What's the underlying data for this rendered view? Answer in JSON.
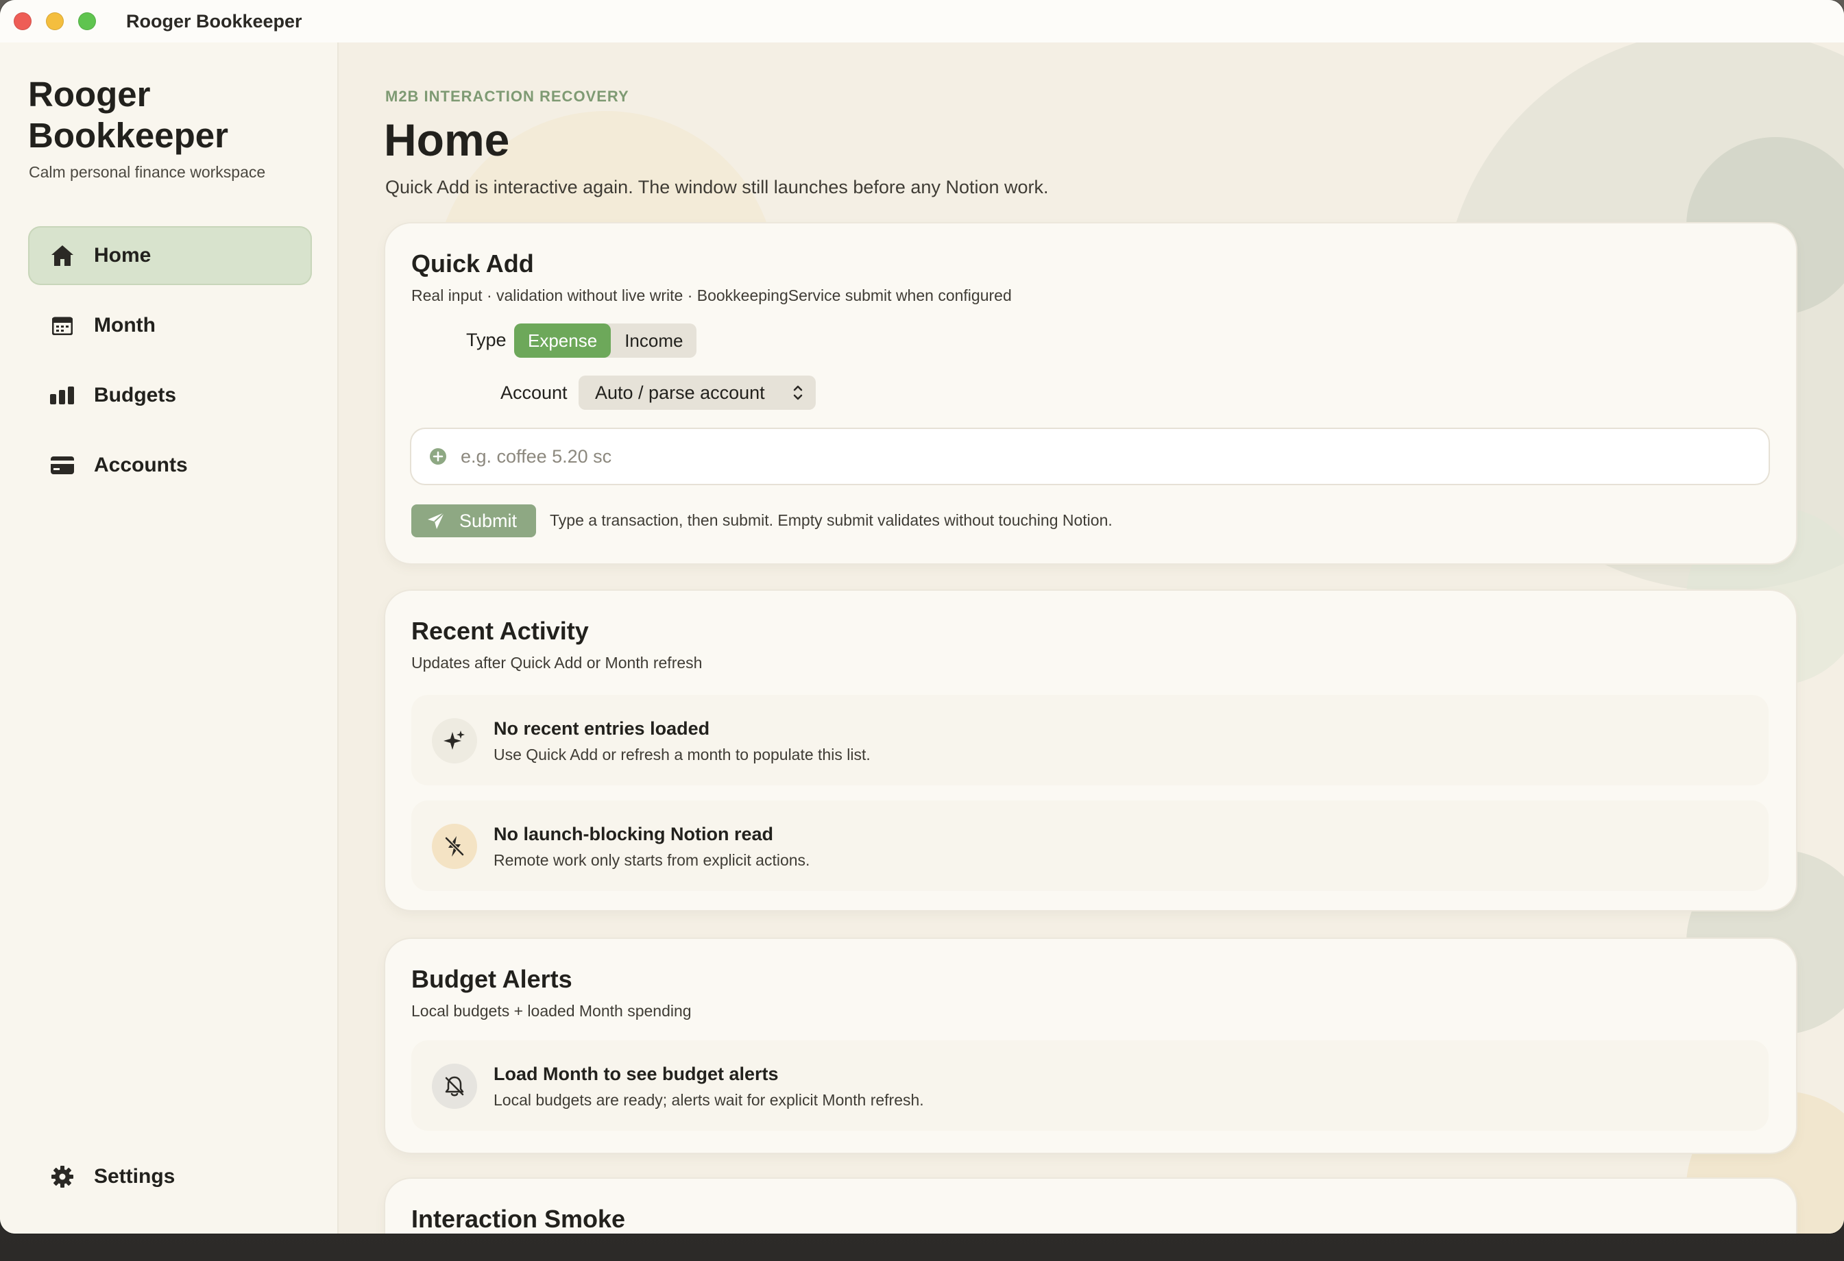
{
  "window": {
    "title": "Rooger Bookkeeper"
  },
  "sidebar": {
    "brand_title": "Rooger Bookkeeper",
    "brand_subtitle": "Calm personal finance workspace",
    "items": [
      {
        "label": "Home",
        "icon": "house-icon",
        "active": true
      },
      {
        "label": "Month",
        "icon": "calendar-icon",
        "active": false
      },
      {
        "label": "Budgets",
        "icon": "bar-chart-icon",
        "active": false
      },
      {
        "label": "Accounts",
        "icon": "credit-card-icon",
        "active": false
      }
    ],
    "settings_label": "Settings"
  },
  "header": {
    "eyebrow": "M2B INTERACTION RECOVERY",
    "title": "Home",
    "subtitle": "Quick Add is interactive again. The window still launches before any Notion work."
  },
  "quick_add": {
    "title": "Quick Add",
    "subtitle": "Real input · validation without live write · BookkeepingService submit when configured",
    "type_label": "Type",
    "type_options": [
      "Expense",
      "Income"
    ],
    "type_selected": "Expense",
    "account_label": "Account",
    "account_value": "Auto / parse account",
    "input_placeholder": "e.g. coffee 5.20 sc",
    "input_value": "",
    "submit_label": "Submit",
    "submit_hint": "Type a transaction, then submit. Empty submit validates without touching Notion."
  },
  "recent_activity": {
    "title": "Recent Activity",
    "subtitle": "Updates after Quick Add or Month refresh",
    "items": [
      {
        "title": "No recent entries loaded",
        "subtitle": "Use Quick Add or refresh a month to populate this list.",
        "icon": "sparkle-icon"
      },
      {
        "title": "No launch-blocking Notion read",
        "subtitle": "Remote work only starts from explicit actions.",
        "icon": "bolt-slash-icon"
      }
    ]
  },
  "budget_alerts": {
    "title": "Budget Alerts",
    "subtitle": "Local budgets + loaded Month spending",
    "items": [
      {
        "title": "Load Month to see budget alerts",
        "subtitle": "Local budgets are ready; alerts wait for explicit Month refresh.",
        "icon": "bell-slash-icon"
      }
    ]
  },
  "interaction_smoke": {
    "title": "Interaction Smoke"
  },
  "colors": {
    "accent": "#6da85a",
    "submit": "#8ea883",
    "active_nav": "#d8e3cd",
    "eyebrow": "#7e9a73"
  }
}
